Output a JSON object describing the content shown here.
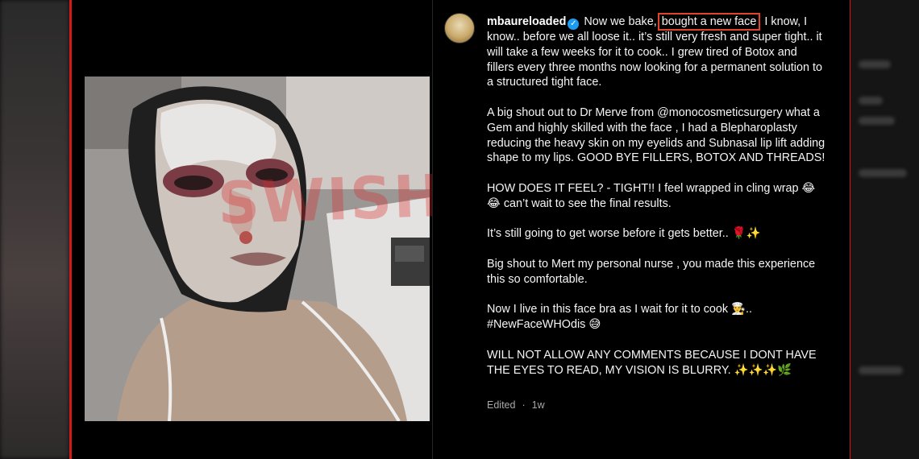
{
  "post": {
    "username": "mbaureloaded",
    "verified_icon": "verified-badge-icon",
    "caption": {
      "p1_before": "Now we bake, ",
      "p1_highlight": "bought a new face",
      "p1_after": ". I know, I know.. before we all loose it.. it’s still very fresh and super tight.. it will take a few weeks for it to cook.. I grew tired of Botox and fillers every three months now looking for a permanent solution to a structured tight face.",
      "p2": "A big shout out to Dr Merve from @monocosmeticsurgery what a Gem and highly skilled with the face , I had a Blepharoplasty reducing the heavy skin on my eyelids and Subnasal lip lift adding shape to my lips. GOOD BYE FILLERS, BOTOX AND THREADS!",
      "p3": "HOW DOES IT FEEL? - TIGHT!! I feel wrapped in cling wrap 😂😂 can’t wait to see the final results.",
      "p4": "It’s still going to get worse before it gets better.. 🌹✨",
      "p5": "Big shout to Mert my personal nurse , you made this experience this so comfortable.",
      "p6": "Now I live in this face bra as I wait for it to cook 👨‍🍳.. #NewFaceWHOdis 😅",
      "p7": "WILL NOT ALLOW ANY COMMENTS BECAUSE I DONT HAVE THE EYES TO READ, MY VISION IS BLURRY. ✨✨✨🌿"
    },
    "meta": {
      "edited": "Edited",
      "time": "1w"
    }
  },
  "watermark": "SWISHERPOST",
  "colors": {
    "highlight_box": "#e0442b",
    "side_border": "#d31a1a",
    "verified": "#1d9bf0",
    "background": "#000000"
  }
}
